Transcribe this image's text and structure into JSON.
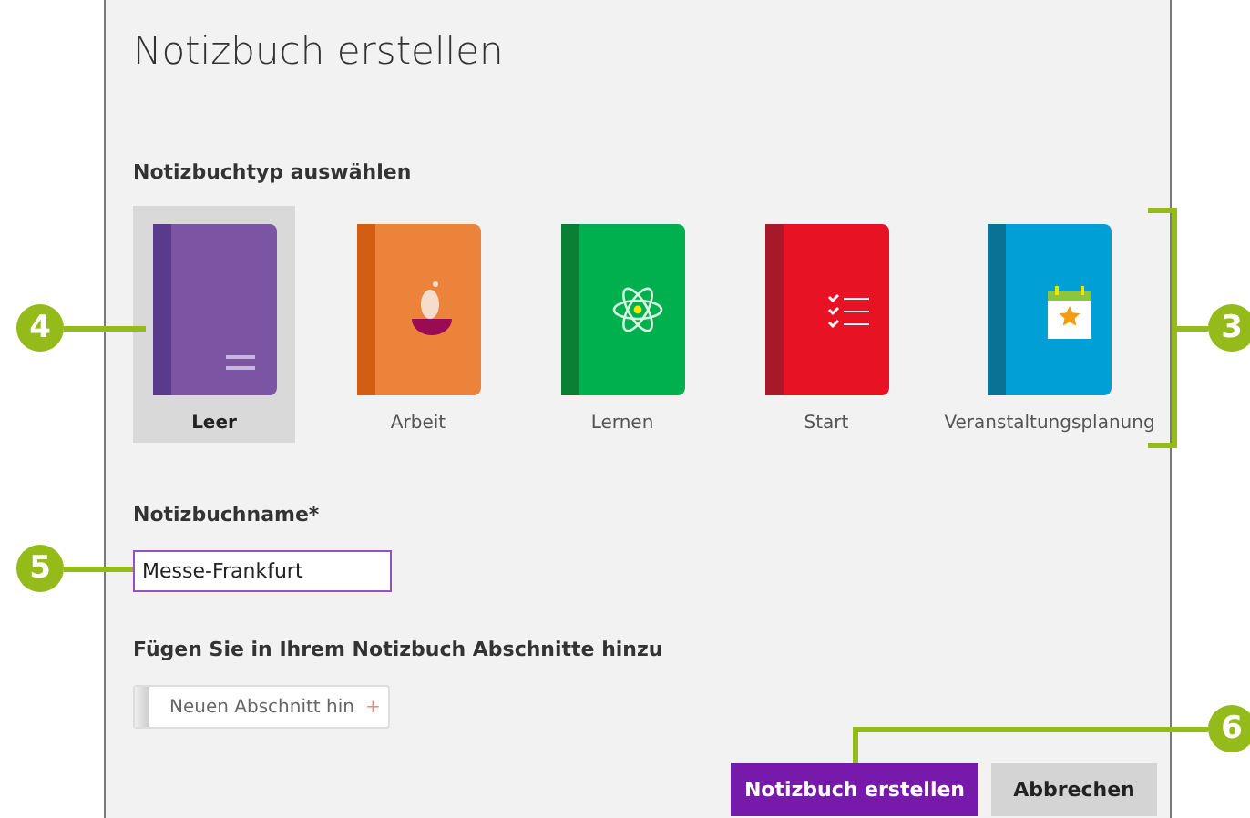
{
  "dialog": {
    "title": "Notizbuch erstellen",
    "type_heading": "Notizbuchtyp auswählen",
    "types": [
      {
        "label": "Leer",
        "kind": "blank",
        "selected": true
      },
      {
        "label": "Arbeit",
        "kind": "work",
        "selected": false
      },
      {
        "label": "Lernen",
        "kind": "learn",
        "selected": false
      },
      {
        "label": "Start",
        "kind": "start",
        "selected": false
      },
      {
        "label": "Veranstaltungsplanung",
        "kind": "event",
        "selected": false
      }
    ],
    "name_label": "Notizbuchname*",
    "name_value": "Messe-Frankfurt",
    "sections_label": "Fügen Sie in Ihrem Notizbuch Abschnitte hinzu",
    "section_button": {
      "label": "Neuen Abschnitt hin",
      "icon": "+"
    },
    "buttons": [
      {
        "label": "Notizbuch erstellen",
        "kind": "primary"
      },
      {
        "label": "Abbrechen",
        "kind": "secondary"
      }
    ]
  },
  "callouts": [
    {
      "number": "4"
    },
    {
      "number": "5"
    },
    {
      "number": "3"
    },
    {
      "number": "6"
    }
  ]
}
